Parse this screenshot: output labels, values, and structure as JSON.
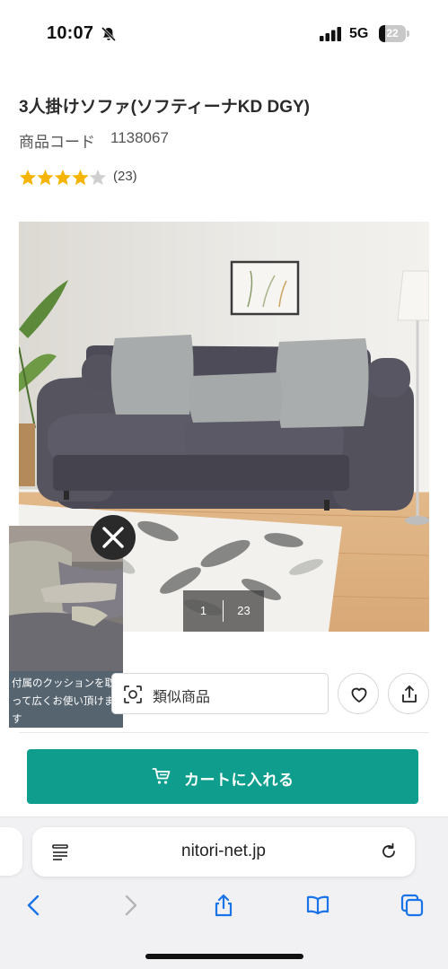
{
  "status_bar": {
    "time": "10:07",
    "network": "5G",
    "battery_percent": "22",
    "battery_level": 0.22
  },
  "product": {
    "title": "3人掛けソファ(ソフティーナKD DGY)",
    "code_label": "商品コード",
    "code_value": "1138067",
    "rating": 4,
    "rating_max": 5,
    "review_count": "(23)"
  },
  "gallery": {
    "current": "1",
    "total": "23"
  },
  "video": {
    "caption": "付属のクッションを取って広くお使い頂けます"
  },
  "actions": {
    "similar_label": "類似商品",
    "cart_label": "カートに入れる"
  },
  "browser": {
    "url": "nitori-net.jp"
  },
  "colors": {
    "accent": "#0f9e8e",
    "star": "#f5b400",
    "star_empty": "#cfcfcf"
  }
}
